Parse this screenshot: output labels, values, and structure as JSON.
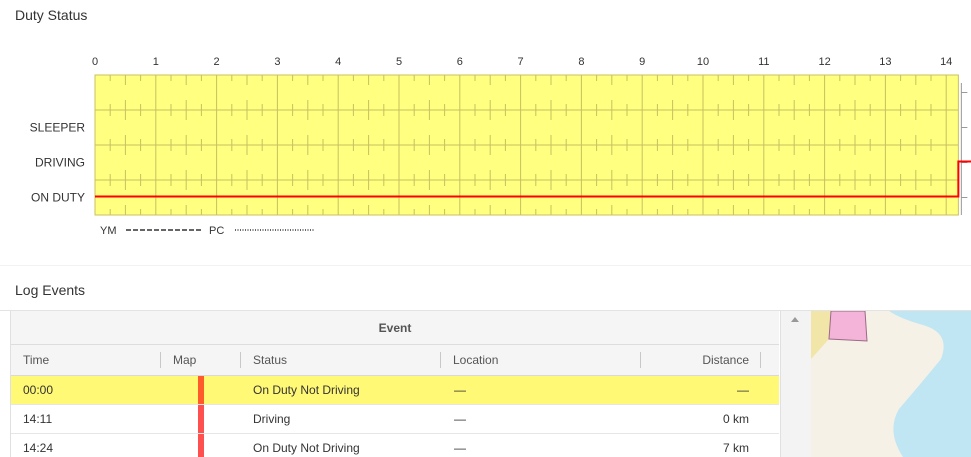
{
  "duty_status": {
    "title": "Duty Status",
    "hours": [
      "0",
      "1",
      "2",
      "3",
      "4",
      "5",
      "6",
      "7",
      "8",
      "9",
      "10",
      "11",
      "12",
      "13",
      "14"
    ],
    "rows": [
      "",
      "SLEEPER",
      "DRIVING",
      "ON DUTY"
    ],
    "legend": {
      "ym": "YM",
      "pc": "PC"
    },
    "current_hour": 14.2,
    "colors": {
      "grid_bg": "#ffff80",
      "grid_line": "#c8c060",
      "status_line": "#ff0000"
    }
  },
  "log_events": {
    "title": "Log Events",
    "group_header": "Event",
    "columns": {
      "time": "Time",
      "map": "Map",
      "status": "Status",
      "location": "Location",
      "distance": "Distance"
    },
    "rows": [
      {
        "time": "00:00",
        "status": "On Duty Not Driving",
        "location": "—",
        "distance": "—",
        "selected": true,
        "map_color": "#ff5a2a"
      },
      {
        "time": "14:11",
        "status": "Driving",
        "location": "—",
        "distance": "0 km",
        "selected": false,
        "map_color": "#ff5050"
      },
      {
        "time": "14:24",
        "status": "On Duty Not Driving",
        "location": "—",
        "distance": "7 km",
        "selected": false,
        "map_color": "#ff5050"
      }
    ]
  },
  "map": {
    "colors": {
      "land": "#f6f1e6",
      "water": "#bfe6f2",
      "poi": "#f4b3d8",
      "park": "#f2e5a8"
    }
  }
}
